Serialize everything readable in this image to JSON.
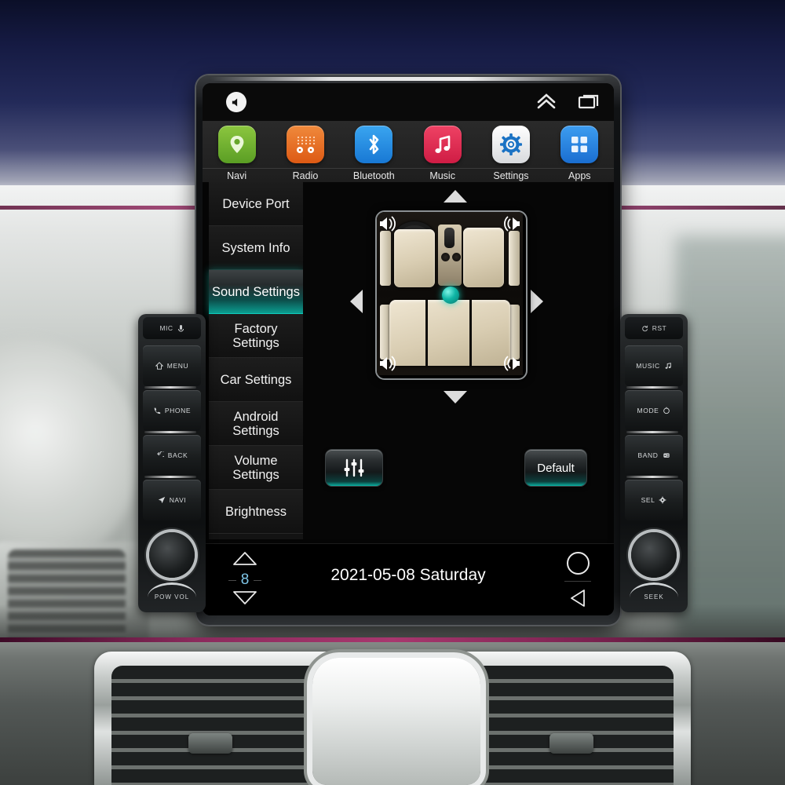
{
  "statusbar": {
    "mute_icon": "speaker-mute-icon",
    "expand_icon": "double-chevron-up-icon",
    "recents_icon": "recent-apps-icon"
  },
  "dock": {
    "apps": [
      {
        "label": "Navi",
        "icon": "location-pin-icon"
      },
      {
        "label": "Radio",
        "icon": "radio-icon"
      },
      {
        "label": "Bluetooth",
        "icon": "bluetooth-icon"
      },
      {
        "label": "Music",
        "icon": "music-note-icon"
      },
      {
        "label": "Settings",
        "icon": "gear-icon"
      },
      {
        "label": "Apps",
        "icon": "grid-apps-icon"
      }
    ]
  },
  "sidebar": {
    "items": [
      {
        "label": "Device Port",
        "selected": false
      },
      {
        "label": "System Info",
        "selected": false
      },
      {
        "label": "Sound Settings",
        "selected": true
      },
      {
        "label": "Factory Settings",
        "selected": false
      },
      {
        "label": "Car Settings",
        "selected": false
      },
      {
        "label": "Android Settings",
        "selected": false
      },
      {
        "label": "Volume Settings",
        "selected": false
      },
      {
        "label": "Brightness",
        "selected": false
      }
    ]
  },
  "sound_panel": {
    "title": "Sound Settings",
    "fader_up_icon": "triangle-up-icon",
    "fader_down_icon": "triangle-down-icon",
    "balance_left_icon": "triangle-left-icon",
    "balance_right_icon": "triangle-right-icon",
    "balance_dot": "balance-position-dot",
    "speakers": [
      "front-left-speaker",
      "front-right-speaker",
      "rear-left-speaker",
      "rear-right-speaker"
    ],
    "equalizer_icon": "equalizer-sliders-icon",
    "default_label": "Default",
    "accent_color": "#0ab0a1"
  },
  "bottombar": {
    "volume_up_icon": "triangle-up-icon",
    "volume_value": "8",
    "volume_down_icon": "triangle-down-icon",
    "datetime": "2021-05-08  Saturday",
    "home_icon": "home-circle-icon",
    "back_icon": "back-triangle-icon"
  },
  "hardware": {
    "left_panel": {
      "top_label": "MIC",
      "top_icon": "microphone-icon",
      "keys": [
        {
          "label": "MENU",
          "icon": "home-icon"
        },
        {
          "label": "PHONE",
          "icon": "phone-icon"
        },
        {
          "label": "BACK",
          "icon": "back-arrow-icon"
        },
        {
          "label": "NAVI",
          "icon": "navigation-arrow-icon"
        }
      ],
      "knob_label": "POW VOL"
    },
    "right_panel": {
      "top_label": "RST",
      "top_icon": "reset-icon",
      "keys": [
        {
          "label": "MUSIC",
          "icon": "music-note-icon"
        },
        {
          "label": "MODE",
          "icon": "mode-circle-icon"
        },
        {
          "label": "BAND",
          "icon": "band-icon"
        },
        {
          "label": "SEL",
          "icon": "gear-icon"
        }
      ],
      "knob_label": "SEEK"
    }
  },
  "theme": {
    "accent": "#0ab0a1",
    "screen_bg": "#000000",
    "dock_bg": "#242424",
    "sidebar_bg": "#141414",
    "text": "#f2f2f2",
    "volume_number": "#7fc6e8",
    "trim": "#a8376e"
  }
}
